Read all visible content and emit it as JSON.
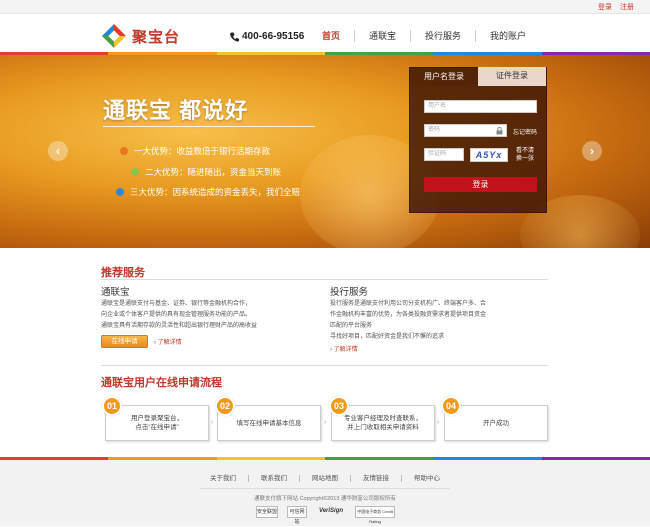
{
  "topbar": {
    "login": "登录",
    "register": "注册"
  },
  "header": {
    "logo_text": "聚宝台",
    "phone": "400-66-95156",
    "nav": [
      "首页",
      "通联宝",
      "投行服务",
      "我的账户"
    ]
  },
  "colors": {
    "brand_red": "#c0392b",
    "orange": "#f29a1e",
    "login_btn": "#c1121b"
  },
  "banner": {
    "slogan": "通联宝 都说好",
    "advantages": [
      {
        "text": "一大优势：收益数倍于银行活期存款",
        "color": "#e8781e"
      },
      {
        "text": "二大优势：随进随出，资金当天到账",
        "color": "#8bc34a"
      },
      {
        "text": "三大优势：因系统造成的资金丢失，我们全赔",
        "color": "#2f86d8"
      }
    ],
    "prev_icon": "chevron-left-icon",
    "next_icon": "chevron-right-icon"
  },
  "login": {
    "tab_username": "用户名登录",
    "tab_cert": "证件登录",
    "username_placeholder": "用户名",
    "password_placeholder": "密码",
    "forgot": "忘记密码",
    "captcha_placeholder": "验证码",
    "captcha_text": "A5Yx",
    "captcha_hint1": "看不清",
    "captcha_hint2": "换一张",
    "submit": "登录"
  },
  "recommend": {
    "title": "推荐服务",
    "tonglianbao": {
      "title": "通联宝",
      "desc": [
        "通联宝是通联支付与基金、证券、银行等金融机构合作，",
        "向企业或个体客户提供的具有现金管理服务功能的产品。",
        "通联宝具有活期存款的灵活性和超出银行理财产品的高收益"
      ],
      "apply": "在线申请",
      "more": "了解详情"
    },
    "touhang": {
      "title": "投行服务",
      "desc": [
        "投行服务是通联支付利用公司分支机构广、终端客户多、合",
        "作金融机构丰富的优势，为各类投融资需求者提供项目资金",
        "匹配的平台服务",
        "寻找好项目，匹配好资金是我们不懈的追求"
      ],
      "more": "了解详情"
    }
  },
  "process": {
    "title": "通联宝用户在线申请流程",
    "steps": [
      {
        "num": "01",
        "line1": "用户登录聚宝台，",
        "line2": "点击“在线申请”"
      },
      {
        "num": "02",
        "line1": "填写在线申请基本信息",
        "line2": ""
      },
      {
        "num": "03",
        "line1": "专业客户经理及时查联系，",
        "line2": "并上门收取相关申请资料"
      },
      {
        "num": "04",
        "line1": "开户成功",
        "line2": ""
      }
    ]
  },
  "footer": {
    "links": [
      "关于我们",
      "联系我们",
      "网站地图",
      "友情链接",
      "帮助中心"
    ],
    "copyright": "通联支付旗下网站 Copyright©2013  通华财富公司版权所有",
    "badges": [
      "安全联盟",
      "可信网站",
      "VeriSign",
      "中国电子商务 Credit Rating"
    ]
  }
}
